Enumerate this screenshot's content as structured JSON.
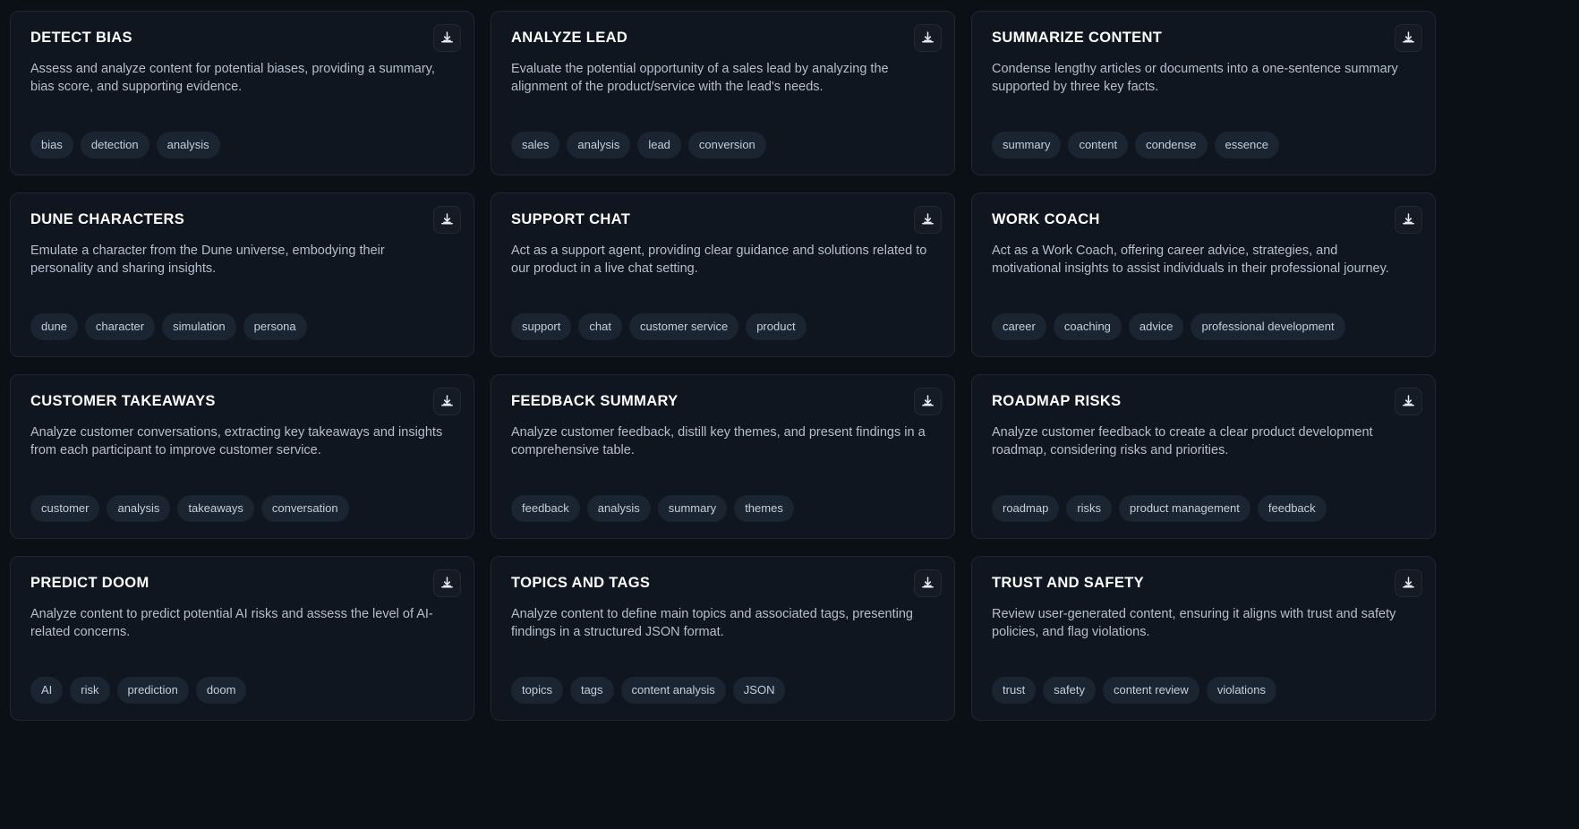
{
  "theme": {
    "page_background": "#0b0f16",
    "card_background": "#10161f",
    "card_border": "#1e2733",
    "title_color": "#ffffff",
    "description_color": "#b3bfcd",
    "tag_background": "#1b2531",
    "tag_text_color": "#c3cedb",
    "icon_color": "#e8edf3"
  },
  "download_icon_name": "download-icon",
  "cards": [
    {
      "title": "DETECT BIAS",
      "description": "Assess and analyze content for potential biases, providing a summary,\nbias score, and supporting evidence.",
      "tags": [
        "bias",
        "detection",
        "analysis"
      ],
      "download_label": "Download"
    },
    {
      "title": "ANALYZE LEAD",
      "description": "Evaluate the potential opportunity of a sales lead by analyzing the\nalignment of the product/service with the lead's needs.",
      "tags": [
        "sales",
        "analysis",
        "lead",
        "conversion"
      ],
      "download_label": "Download"
    },
    {
      "title": "SUMMARIZE CONTENT",
      "description": "Condense lengthy articles or documents into a one-sentence summary\nsupported by three key facts.",
      "tags": [
        "summary",
        "content",
        "condense",
        "essence"
      ],
      "download_label": "Download"
    },
    {
      "title": "DUNE CHARACTERS",
      "description": "Emulate a character from the Dune universe, embodying their\npersonality and sharing insights.",
      "tags": [
        "dune",
        "character",
        "simulation",
        "persona"
      ],
      "download_label": "Download"
    },
    {
      "title": "SUPPORT CHAT",
      "description": "Act as a support agent, providing clear guidance and solutions related to\nour product in a live chat setting.",
      "tags": [
        "support",
        "chat",
        "customer service",
        "product"
      ],
      "download_label": "Download"
    },
    {
      "title": "WORK COACH",
      "description": "Act as a Work Coach, offering career advice, strategies, and\nmotivational insights to assist individuals in their professional journey.",
      "tags": [
        "career",
        "coaching",
        "advice",
        "professional development"
      ],
      "download_label": "Download"
    },
    {
      "title": "CUSTOMER TAKEAWAYS",
      "description": "Analyze customer conversations, extracting key takeaways and insights\nfrom each participant to improve customer service.",
      "tags": [
        "customer",
        "analysis",
        "takeaways",
        "conversation"
      ],
      "download_label": "Download"
    },
    {
      "title": "FEEDBACK SUMMARY",
      "description": "Analyze customer feedback, distill key themes, and present findings in a\ncomprehensive table.",
      "tags": [
        "feedback",
        "analysis",
        "summary",
        "themes"
      ],
      "download_label": "Download"
    },
    {
      "title": "ROADMAP RISKS",
      "description": "Analyze customer feedback to create a clear product development\nroadmap, considering risks and priorities.",
      "tags": [
        "roadmap",
        "risks",
        "product management",
        "feedback"
      ],
      "download_label": "Download"
    },
    {
      "title": "PREDICT DOOM",
      "description": "Analyze content to predict potential AI risks and assess the level of AI-\nrelated concerns.",
      "tags": [
        "AI",
        "risk",
        "prediction",
        "doom"
      ],
      "download_label": "Download"
    },
    {
      "title": "TOPICS AND TAGS",
      "description": "Analyze content to define main topics and associated tags, presenting\nfindings in a structured JSON format.",
      "tags": [
        "topics",
        "tags",
        "content analysis",
        "JSON"
      ],
      "download_label": "Download"
    },
    {
      "title": "TRUST AND SAFETY",
      "description": "Review user-generated content, ensuring it aligns with trust and safety\npolicies, and flag violations.",
      "tags": [
        "trust",
        "safety",
        "content review",
        "violations"
      ],
      "download_label": "Download"
    }
  ]
}
